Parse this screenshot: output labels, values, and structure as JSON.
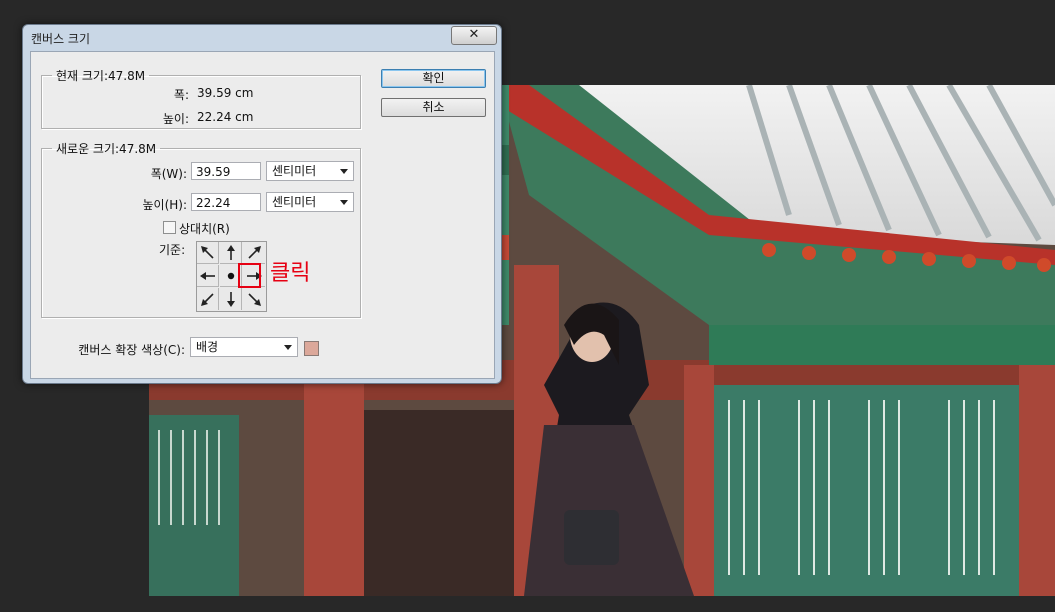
{
  "dialog": {
    "title": "캔버스 크기",
    "close_icon_name": "close-icon",
    "ok_label": "확인",
    "cancel_label": "취소",
    "current": {
      "legend": "현재 크기:47.8M",
      "width_label": "폭:",
      "width_value": "39.59 cm",
      "height_label": "높이:",
      "height_value": "22.24 cm"
    },
    "new": {
      "legend": "새로운 크기:47.8M",
      "width_label": "폭(W):",
      "width_value": "39.59",
      "width_unit": "센티미터",
      "height_label": "높이(H):",
      "height_value": "22.24",
      "height_unit": "센티미터",
      "relative_label": "상대치(R)",
      "relative_checked": false,
      "anchor_label": "기준:"
    },
    "extension_color_label": "캔버스 확장 색상(C):",
    "extension_color_value": "배경",
    "extension_swatch_color": "#dca89a"
  },
  "annotation": {
    "text": "클릭",
    "color": "#e60012"
  }
}
